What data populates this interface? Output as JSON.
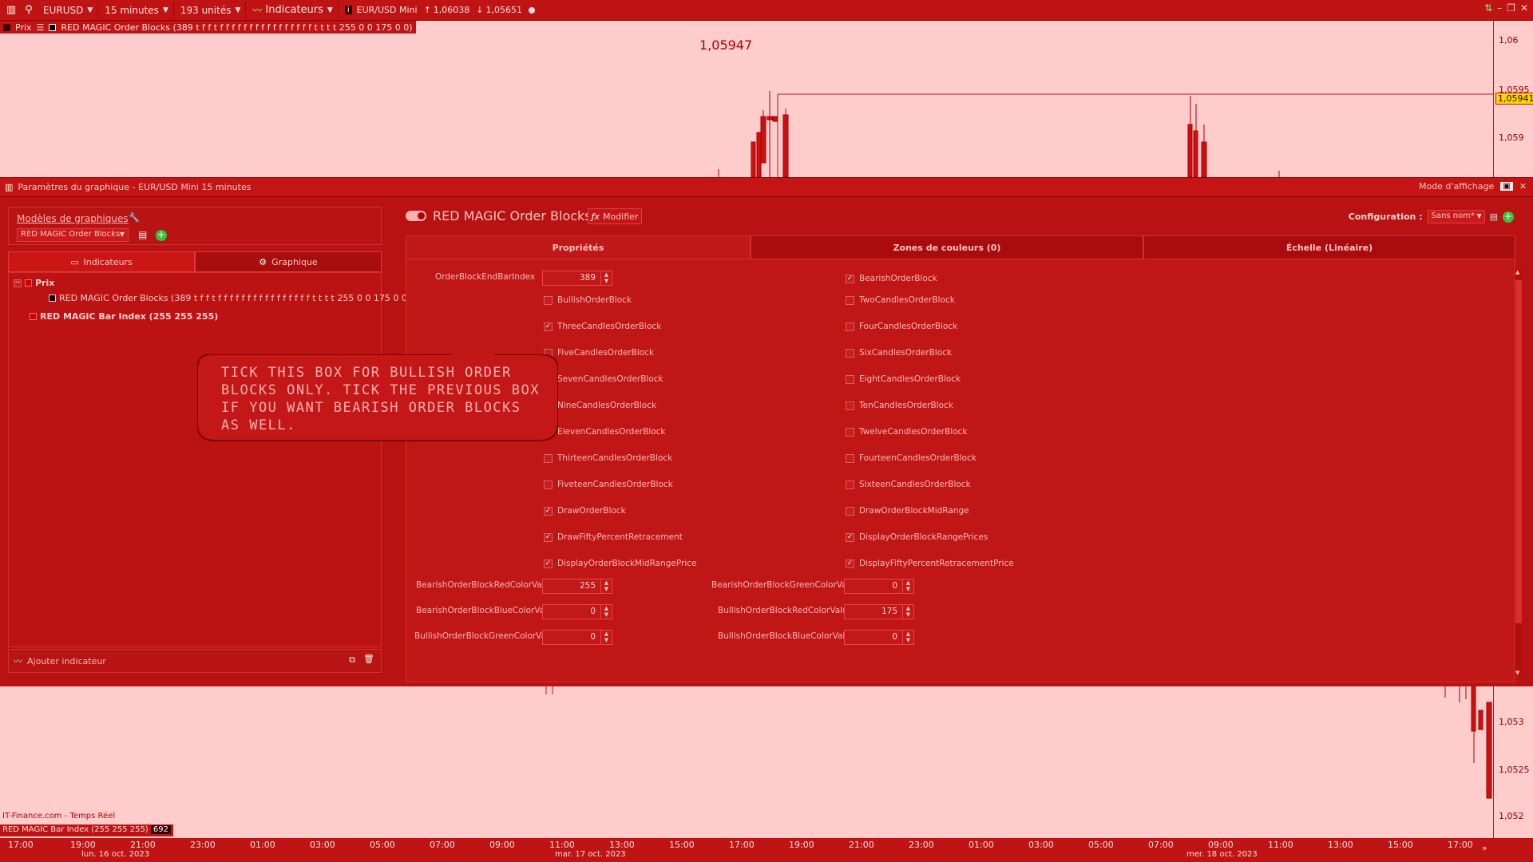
{
  "toolbar": {
    "symbol": "EURUSD",
    "timeframe": "15 minutes",
    "units": "193 unités",
    "indicators_label": "Indicateurs",
    "instrument": "EUR/USD Mini",
    "price_up": "1,06038",
    "price_down": "1,05651"
  },
  "chart": {
    "legend_prix": "Prix",
    "legend_indicator": "RED MAGIC Order Blocks (389 t f f t f f f f f f f f f f f f f f f f t t t t 255 0 0 175 0 0)",
    "big_price": "1,05947",
    "axis_labels": [
      "1,06",
      "1,0595",
      "1,059",
      "1,053",
      "1,0525",
      "1,052"
    ],
    "current_price_tag": "1,05941",
    "source": "IT-Finance.com - Temps Réel",
    "bar_index_label": "RED MAGIC Bar Index (255 255 255)",
    "bar_index_value": "692",
    "times": [
      "17:00",
      "19:00",
      "21:00",
      "23:00",
      "01:00",
      "03:00",
      "05:00",
      "07:00",
      "09:00",
      "11:00",
      "13:00",
      "15:00",
      "17:00",
      "19:00",
      "21:00",
      "23:00",
      "01:00",
      "03:00",
      "05:00",
      "07:00",
      "09:00",
      "11:00",
      "13:00",
      "15:00",
      "17:00"
    ],
    "dates": [
      "lun. 16 oct. 2023",
      "mar. 17 oct. 2023",
      "mer. 18 oct. 2023"
    ]
  },
  "dialog": {
    "title": "Paramètres du graphique - EUR/USD Mini 15 minutes",
    "display_mode": "Mode d'affichage",
    "models_title": "Modèles de graphiques",
    "models_selected": "RED MAGIC Order Blocks",
    "tab_indicators": "Indicateurs",
    "tab_chart": "Graphique",
    "tree": {
      "prix": "Prix",
      "order_blocks": "RED MAGIC Order Blocks (389 t f f t f f f f f f f f f f f f f f f f t t t t 255 0 0 175 0 0)",
      "bar_index": "RED MAGIC Bar Index (255 255 255)"
    },
    "add_indicator": "Ajouter indicateur",
    "indicator_name": "RED MAGIC Order Blocks",
    "modify": "Modifier",
    "config_label": "Configuration :",
    "config_value": "Sans nom*",
    "tabs": [
      "Propriétés",
      "Zones de couleurs (0)",
      "Échelle (Linéaire)"
    ],
    "end_bar_label": "OrderBlockEndBarIndex",
    "end_bar_value": "389",
    "checkboxes_left": [
      {
        "label": "BullishOrderBlock",
        "checked": false
      },
      {
        "label": "ThreeCandlesOrderBlock",
        "checked": true
      },
      {
        "label": "FiveCandlesOrderBlock",
        "checked": false
      },
      {
        "label": "SevenCandlesOrderBlock",
        "checked": false
      },
      {
        "label": "NineCandlesOrderBlock",
        "checked": false
      },
      {
        "label": "ElevenCandlesOrderBlock",
        "checked": false
      },
      {
        "label": "ThirteenCandlesOrderBlock",
        "checked": false
      },
      {
        "label": "FiveteenCandlesOrderBlock",
        "checked": false
      },
      {
        "label": "DrawOrderBlock",
        "checked": true
      },
      {
        "label": "DrawFiftyPercentRetracement",
        "checked": true
      },
      {
        "label": "DisplayOrderBlockMidRangePrice",
        "checked": true
      }
    ],
    "checkboxes_right": [
      {
        "label": "BearishOrderBlock",
        "checked": true
      },
      {
        "label": "TwoCandlesOrderBlock",
        "checked": false
      },
      {
        "label": "FourCandlesOrderBlock",
        "checked": false
      },
      {
        "label": "SixCandlesOrderBlock",
        "checked": false
      },
      {
        "label": "EightCandlesOrderBlock",
        "checked": false
      },
      {
        "label": "TenCandlesOrderBlock",
        "checked": false
      },
      {
        "label": "TwelveCandlesOrderBlock",
        "checked": false
      },
      {
        "label": "FourteenCandlesOrderBlock",
        "checked": false
      },
      {
        "label": "SixteenCandlesOrderBlock",
        "checked": false
      },
      {
        "label": "DrawOrderBlockMidRange",
        "checked": false
      },
      {
        "label": "DisplayOrderBlockRangePrices",
        "checked": true
      },
      {
        "label": "DisplayFiftyPercentRetracementPrice",
        "checked": true
      }
    ],
    "colors": [
      {
        "label": "BearishOrderBlockRedColorValue",
        "value": "255"
      },
      {
        "label": "BearishOrderBlockGreenColorValue",
        "value": "0"
      },
      {
        "label": "BearishOrderBlockBlueColorValue",
        "value": "0"
      },
      {
        "label": "BullishOrderBlockRedColorValue",
        "value": "175"
      },
      {
        "label": "BullishOrderBlockGreenColorValue",
        "value": "0"
      },
      {
        "label": "BullishOrderBlockBlueColorValue",
        "value": "0"
      }
    ]
  },
  "callout": {
    "text": "TICK THIS BOX FOR BULLISH ORDER BLOCKS ONLY. TICK THE PREVIOUS BOX IF YOU WANT BEARISH ORDER BLOCKS AS WELL."
  },
  "colors": {
    "accent": "#c01414",
    "chart_bg": "#ffcccc",
    "dialog_bg": "#b81212",
    "price_tag": "#ffd700",
    "add_green": "#3ac03a"
  },
  "icons": [
    "chart-icon",
    "search-icon",
    "indicator-icon",
    "info-icon",
    "arrow-up-icon",
    "arrow-down-icon",
    "wrench-icon",
    "save-icon",
    "add-icon",
    "close-icon",
    "function-icon"
  ]
}
